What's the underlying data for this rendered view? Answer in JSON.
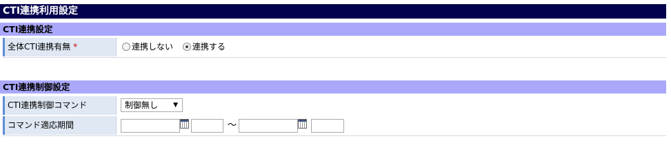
{
  "page": {
    "title": "CTI連携利用設定"
  },
  "sections": {
    "cti_setting": {
      "header": "CTI連携設定",
      "row": {
        "label": "全体CTI連携有無",
        "required_mark": "*",
        "options": [
          {
            "label": "連携しない",
            "checked": false
          },
          {
            "label": "連携する",
            "checked": true
          }
        ]
      }
    },
    "cti_control": {
      "header": "CTI連携制御設定",
      "command_row": {
        "label": "CTI連携制御コマンド",
        "selected": "制御無し"
      },
      "period_row": {
        "label": "コマンド適応期間",
        "start_date": "",
        "start_time": "",
        "separator": "～",
        "end_date": "",
        "end_time": ""
      }
    }
  }
}
